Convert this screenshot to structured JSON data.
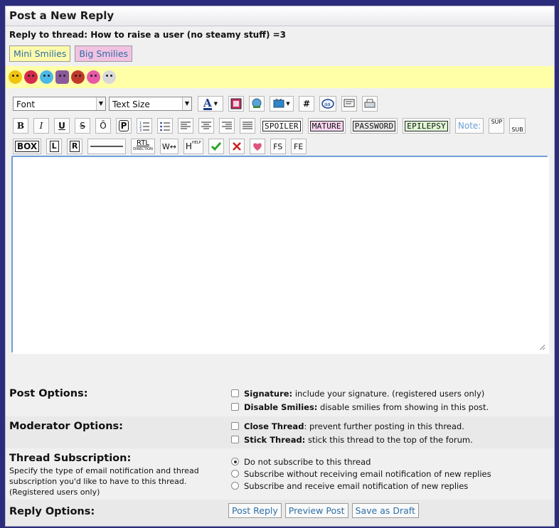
{
  "header": {
    "title": "Post a New Reply"
  },
  "thread": {
    "line": "Reply to thread: How to raise a user (no steamy stuff) =3"
  },
  "smilies_tabs": {
    "mini": "Mini Smilies",
    "big": "Big Smilies"
  },
  "toolbar": {
    "font_select": "Font",
    "size_select": "Text Size",
    "hash_label": "#",
    "bold": "B",
    "italic": "I",
    "underline": "U",
    "strike": "S",
    "overline": "Ō",
    "preformat": "P",
    "spoiler": "SPOILER",
    "mature": "MATURE",
    "password": "PASSWORD",
    "epilepsy": "EPILEPSY",
    "note": "Note:",
    "sup": "SUP",
    "sub": "SUB",
    "box": "BOX",
    "left": "L",
    "right": "R",
    "rtl": "RTL",
    "rtl_sub": "DIRECTION",
    "width_label": "W↔",
    "help_h": "H",
    "help_sup": "HELP",
    "fs": "FS",
    "fe": "FE",
    "colors": {
      "check": "#2aa52a",
      "cross": "#cc2222",
      "heart": "#e0557f"
    }
  },
  "options": {
    "post": {
      "label": "Post Options:",
      "signature_b": "Signature:",
      "signature": " include your signature. (registered users only)",
      "disable_b": "Disable Smilies:",
      "disable": " disable smilies from showing in this post."
    },
    "moderator": {
      "label": "Moderator Options:",
      "close_b": "Close Thread",
      "close": ": prevent further posting in this thread.",
      "stick_b": "Stick Thread:",
      "stick": " stick this thread to the top of the forum."
    },
    "subscription": {
      "label": "Thread Subscription:",
      "desc": "Specify the type of email notification and thread subscription you'd like to have to this thread. (Registered users only)",
      "r1": "Do not subscribe to this thread",
      "r2": "Subscribe without receiving email notification of new replies",
      "r3": "Subscribe and receive email notification of new replies"
    },
    "reply": {
      "label": "Reply Options:",
      "post_btn": "Post Reply",
      "preview_btn": "Preview Post",
      "draft_btn": "Save as Draft"
    }
  }
}
